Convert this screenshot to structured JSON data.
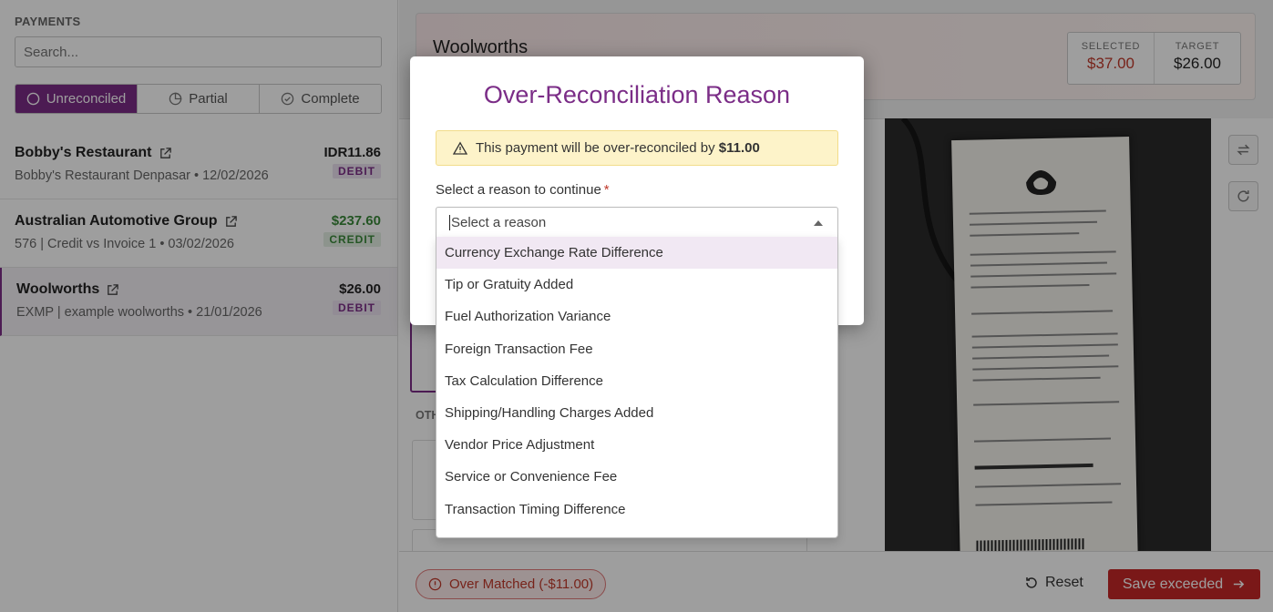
{
  "sidebar": {
    "title": "PAYMENTS",
    "search_placeholder": "Search...",
    "filters": [
      {
        "label": "Unreconciled",
        "active": true
      },
      {
        "label": "Partial",
        "active": false
      },
      {
        "label": "Complete",
        "active": false
      }
    ],
    "payments": [
      {
        "name": "Bobby's Restaurant",
        "subtitle": "Bobby's Restaurant Denpasar • 12/02/2026",
        "amount": "IDR11.86",
        "type": "DEBIT"
      },
      {
        "name": "Australian Automotive Group",
        "subtitle": "576 | Credit vs Invoice 1 • 03/02/2026",
        "amount": "$237.60",
        "type": "CREDIT"
      },
      {
        "name": "Woolworths",
        "subtitle": "EXMP | example woolworths • 21/01/2026",
        "amount": "$26.00",
        "type": "DEBIT"
      }
    ]
  },
  "main": {
    "title": "Woolworths",
    "selected_label": "SELECTED",
    "selected_value": "$37.00",
    "target_label": "TARGET",
    "target_value": "$26.00",
    "other_label": "OTH"
  },
  "footer": {
    "status": "Over Matched (-$11.00)",
    "reset_label": "Reset",
    "save_label": "Save exceeded"
  },
  "modal": {
    "title": "Over-Reconciliation Reason",
    "warning_text": "This payment will be over-reconciled by",
    "warning_amount": "$11.00",
    "field_label": "Select a reason to continue",
    "required_mark": "*",
    "select_placeholder": "Select a reason",
    "options": [
      "Currency Exchange Rate Difference",
      "Tip or Gratuity Added",
      "Fuel Authorization Variance",
      "Foreign Transaction Fee",
      "Tax Calculation Difference",
      "Shipping/Handling Charges Added",
      "Vendor Price Adjustment",
      "Service or Convenience Fee",
      "Transaction Timing Difference"
    ]
  },
  "colors": {
    "accent": "#7b2d87",
    "danger": "#c0392b",
    "warning_bg": "#fdf3c9",
    "credit": "#3a8a3a"
  }
}
